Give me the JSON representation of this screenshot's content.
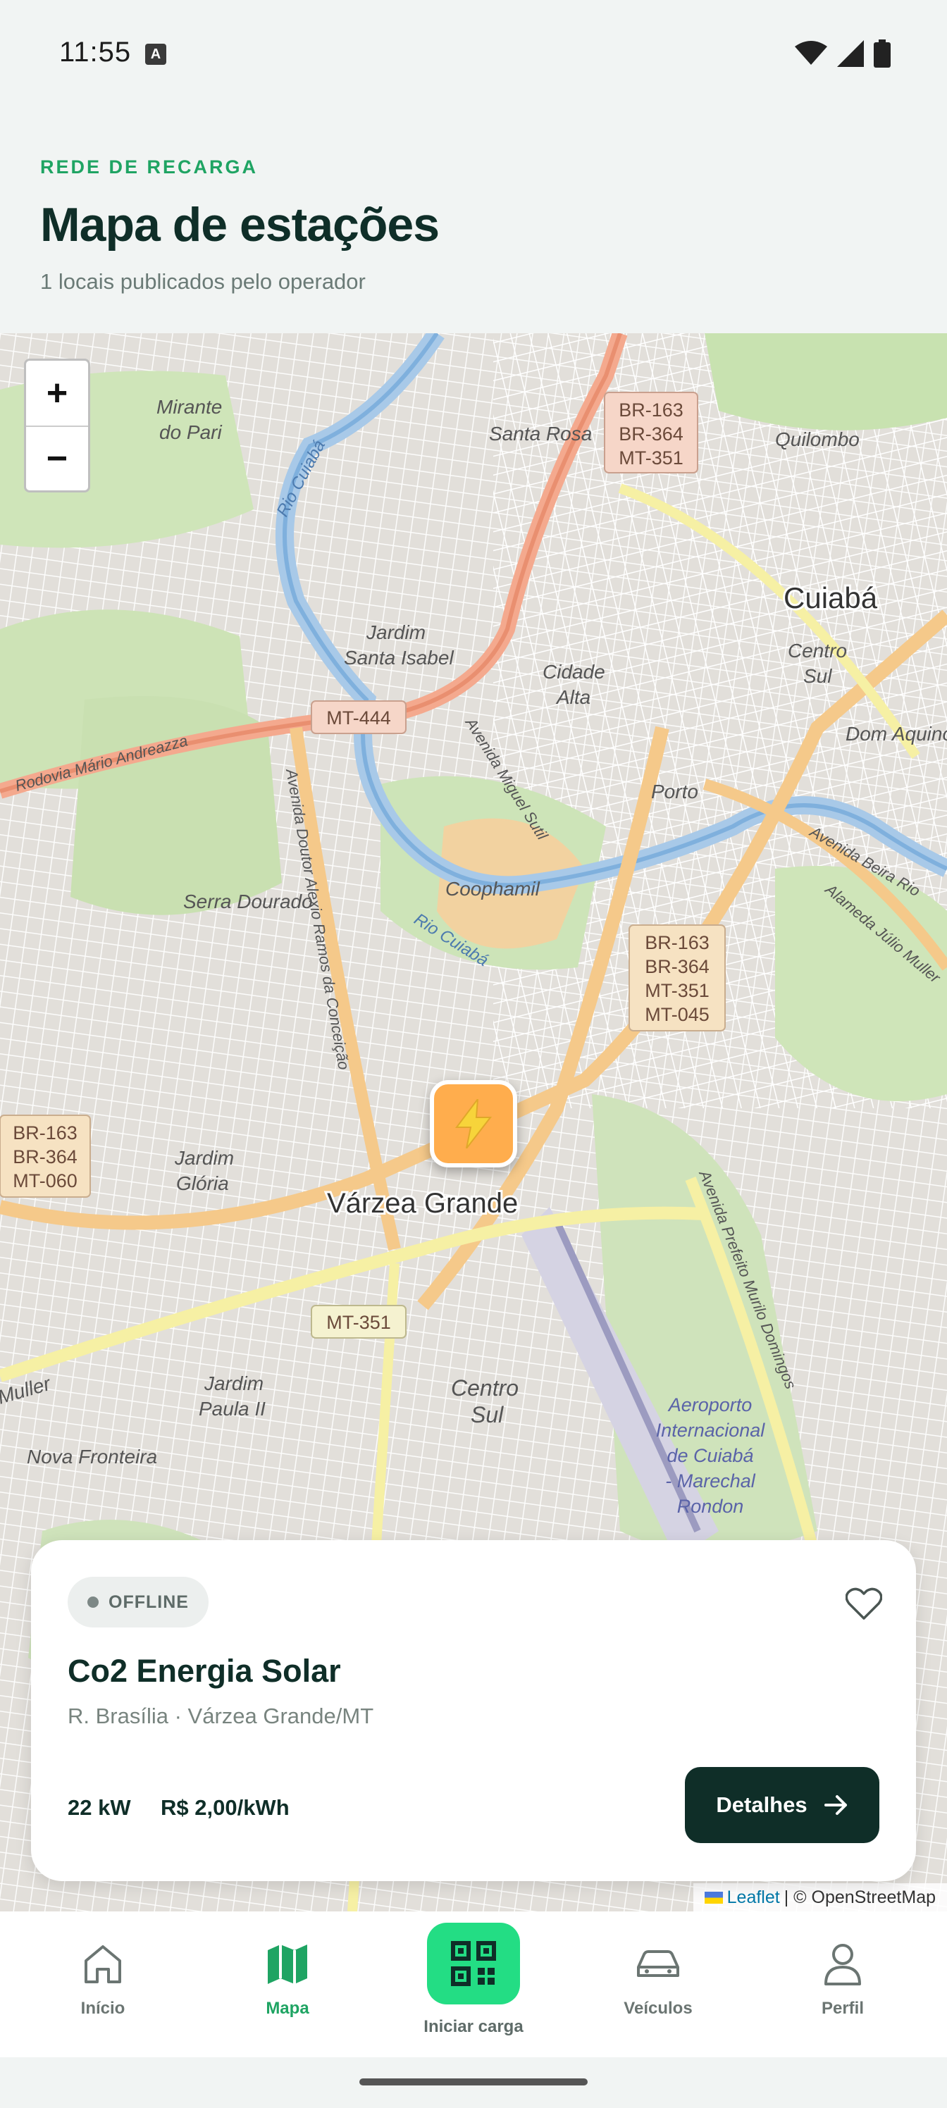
{
  "status_bar": {
    "time": "11:55",
    "notification_badge": "A"
  },
  "header": {
    "eyebrow": "REDE DE RECARGA",
    "title": "Mapa de estações",
    "subtitle": "1 locais publicados pelo operador"
  },
  "map": {
    "zoom_in": "+",
    "zoom_out": "−",
    "labels": {
      "cuiaba": "Cuiabá",
      "varzea_grande": "Várzea Grande",
      "quilombo": "Quilombo",
      "santa_rosa": "Santa Rosa",
      "mirante": "Mirante",
      "do_pari": "do Pari",
      "jardim_santa_isabel_1": "Jardim",
      "jardim_santa_isabel_2": "Santa Isabel",
      "cidade_alta_1": "Cidade",
      "cidade_alta_2": "Alta",
      "centro_sul_1": "Centro",
      "centro_sul_2": "Sul",
      "dom_aquino": "Dom Aquino",
      "porto": "Porto",
      "coophamil": "Coophamil",
      "serra_dourado": "Serra Dourado",
      "jardim_gloria_1": "Jardim",
      "jardim_gloria_2": "Glória",
      "jardim_paula_1": "Jardim",
      "jardim_paula_2": "Paula II",
      "centro_sul_vg_1": "Centro",
      "centro_sul_vg_2": "Sul",
      "nova_fronteira": "Nova Fronteira",
      "aeroporto_1": "Aeroporto",
      "aeroporto_2": "Internacional",
      "aeroporto_3": "de Cuiabá",
      "aeroporto_4": "- Marechal",
      "aeroporto_5": "Rondon",
      "rio_cuiaba_1": "Rio Cuiabá",
      "rio_cuiaba_2": "Rio Cuiabá",
      "rodovia": "Rodovia Mário Andreazza",
      "av_miguel_sutil": "Avenida Miguel Sutil",
      "av_doutor": "Avenida Doutor Alexio Ramos da Conceição",
      "av_prefeito": "Avenida Prefeito Murilo Domingos",
      "av_beira_rio": "Avenida Beira Rio",
      "alameda": "Alameda Júlio Muller",
      "muller": "Muller"
    },
    "shields": {
      "br163_top": [
        "BR-163",
        "BR-364",
        "MT-351"
      ],
      "br163_mid": [
        "BR-163",
        "BR-364",
        "MT-351",
        "MT-045"
      ],
      "br163_left": [
        "BR-163",
        "BR-364",
        "MT-060"
      ],
      "mt444": "MT-444",
      "mt351": "MT-351"
    },
    "attribution": {
      "leaflet": "Leaflet",
      "rest": "| © OpenStreetMap"
    }
  },
  "station_card": {
    "status": "OFFLINE",
    "name": "Co2 Energia Solar",
    "address": "R. Brasília · Várzea Grande/MT",
    "power": "22 kW",
    "price": "R$ 2,00/kWh",
    "details_label": "Detalhes"
  },
  "bottom_nav": {
    "items": [
      {
        "label": "Início",
        "icon": "home-icon"
      },
      {
        "label": "Mapa",
        "icon": "map-icon",
        "active": true
      },
      {
        "label": "Iniciar carga",
        "icon": "qr-code-icon"
      },
      {
        "label": "Veículos",
        "icon": "car-icon"
      },
      {
        "label": "Perfil",
        "icon": "person-icon"
      }
    ]
  },
  "colors": {
    "accent": "#1fa463",
    "qr_button": "#23dd84",
    "dark": "#0f2e28",
    "marker": "#ffad4d"
  }
}
